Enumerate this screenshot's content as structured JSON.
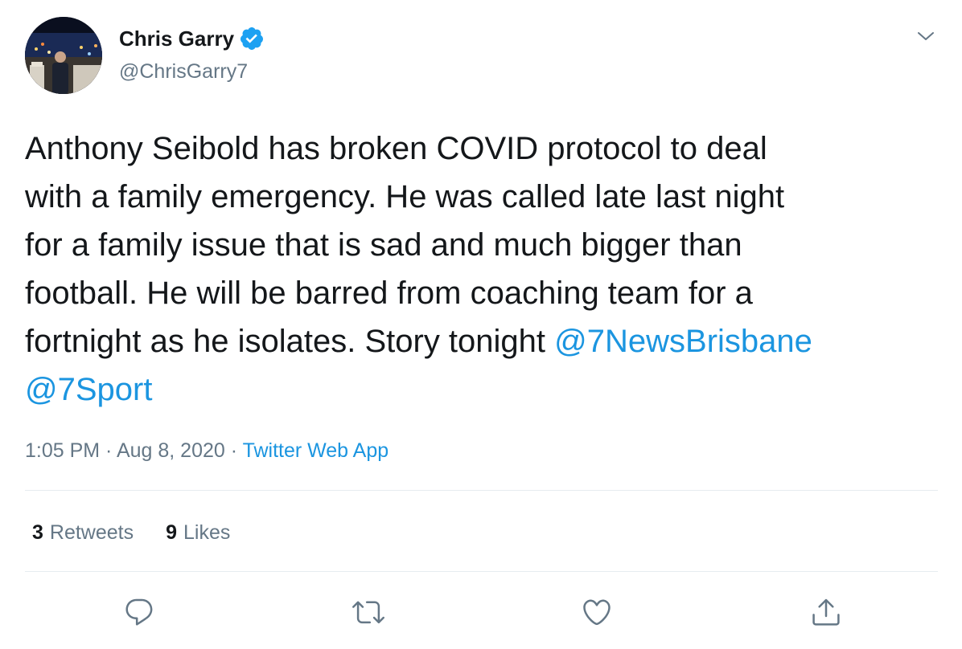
{
  "author": {
    "name": "Chris Garry",
    "handle": "@ChrisGarry7",
    "verified": true
  },
  "tweet": {
    "lines": [
      {
        "text": "Anthony Seibold has broken COVID protocol to deal"
      },
      {
        "text": "with a family emergency. He was called late last night"
      },
      {
        "text": "for a family issue that is sad and much bigger than"
      },
      {
        "text": "football. He will be barred from coaching team for a"
      },
      {
        "text": "fortnight as he isolates. Story tonight ",
        "mention": "@7NewsBrisbane"
      },
      {
        "text": "",
        "mention": "@7Sport"
      }
    ]
  },
  "meta": {
    "time": "1:05 PM",
    "separator1": " · ",
    "date": "Aug 8, 2020",
    "separator2": " · ",
    "source": "Twitter Web App"
  },
  "stats": {
    "retweets_count": "3",
    "retweets_label": "Retweets",
    "likes_count": "9",
    "likes_label": "Likes"
  },
  "actions": {
    "icons": [
      "reply-icon",
      "retweet-icon",
      "like-icon",
      "share-icon"
    ]
  },
  "colors": {
    "link": "#1b95e0",
    "muted": "#657786",
    "text": "#14171a",
    "divider": "#e6ecf0"
  }
}
